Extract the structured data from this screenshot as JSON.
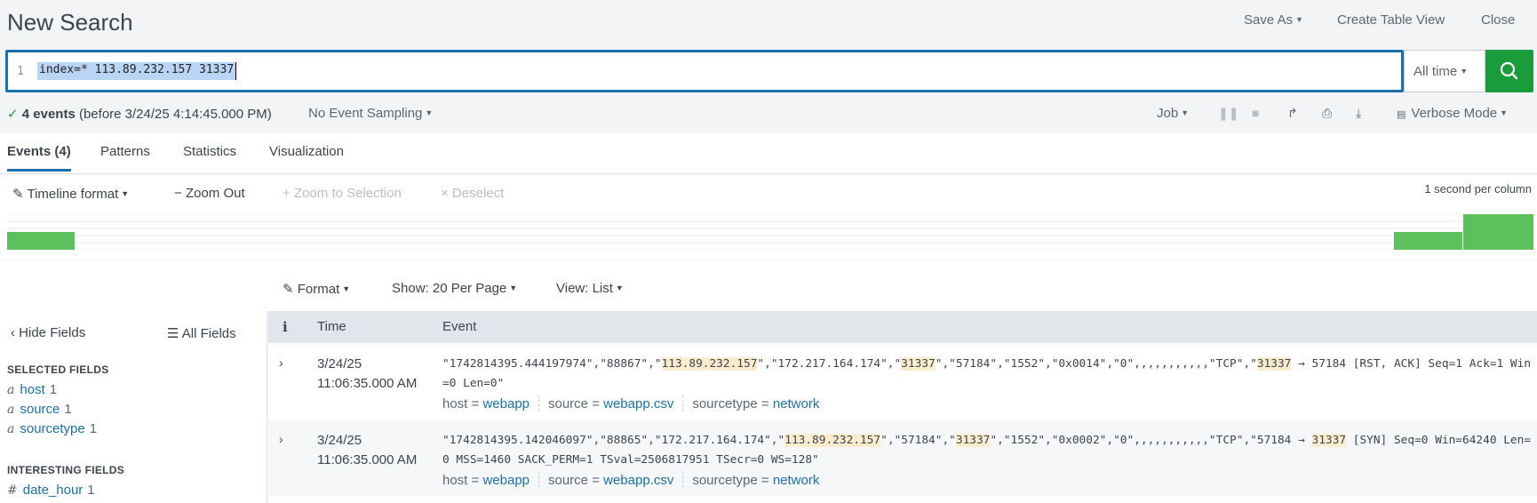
{
  "header": {
    "title": "New Search",
    "save_as": "Save As",
    "create_table_view": "Create Table View",
    "close": "Close"
  },
  "search": {
    "line_number": "1",
    "query": "index=* 113.89.232.157 31337",
    "time_range": "All time"
  },
  "status": {
    "event_count": "4 events",
    "event_time": "(before 3/24/25 4:14:45.000 PM)",
    "sampling": "No Event Sampling",
    "job": "Job",
    "mode": "Verbose Mode"
  },
  "tabs": [
    {
      "label": "Events (4)",
      "active": true
    },
    {
      "label": "Patterns",
      "active": false
    },
    {
      "label": "Statistics",
      "active": false
    },
    {
      "label": "Visualization",
      "active": false
    }
  ],
  "timeline": {
    "format": "Timeline format",
    "zoom_out": "Zoom Out",
    "zoom_selection": "+ Zoom to Selection",
    "deselect": "× Deselect",
    "per_column": "1 second per column",
    "buckets": [
      {
        "position": "first",
        "count": 1
      },
      {
        "position": "second-to-last",
        "count": 1
      },
      {
        "position": "last",
        "count": 2
      }
    ],
    "bar_color": "#5cc05c"
  },
  "results": {
    "format": "Format",
    "show": "Show: 20 Per Page",
    "view": "View: List"
  },
  "sidebar": {
    "hide_fields": "Hide Fields",
    "all_fields": "All Fields",
    "selected_heading": "SELECTED FIELDS",
    "selected": [
      {
        "type": "a",
        "name": "host",
        "count": "1"
      },
      {
        "type": "a",
        "name": "source",
        "count": "1"
      },
      {
        "type": "a",
        "name": "sourcetype",
        "count": "1"
      }
    ],
    "interesting_heading": "INTERESTING FIELDS",
    "interesting": [
      {
        "type": "#",
        "name": "date_hour",
        "count": "1"
      }
    ]
  },
  "events_table": {
    "col_info": "i",
    "col_time": "Time",
    "col_event": "Event",
    "rows": [
      {
        "date": "3/24/25",
        "time": "11:06:35.000 AM",
        "raw_segments": [
          {
            "t": "\"1742814395.444197974\",\"88867\",\"",
            "h": false
          },
          {
            "t": "113.89.232.157",
            "h": true
          },
          {
            "t": "\",\"172.217.164.174\",\"",
            "h": false
          },
          {
            "t": "31337",
            "h": true
          },
          {
            "t": "\",\"57184\",\"1552\",\"0x0014\",\"0\",,,,,,,,,,,\"TCP\",\"",
            "h": false
          },
          {
            "t": "31337",
            "h": true
          },
          {
            "t": " → 57184 [RST, ACK] Seq=1 Ack=1 Win=0 Len=0\"",
            "h": false
          }
        ],
        "host": "webapp",
        "source": "webapp.csv",
        "sourcetype": "network"
      },
      {
        "date": "3/24/25",
        "time": "11:06:35.000 AM",
        "raw_segments": [
          {
            "t": "\"1742814395.142046097\",\"88865\",\"172.217.164.174\",\"",
            "h": false
          },
          {
            "t": "113.89.232.157",
            "h": true
          },
          {
            "t": "\",\"57184\",\"",
            "h": false
          },
          {
            "t": "31337",
            "h": true
          },
          {
            "t": "\",\"1552\",\"0x0002\",\"0\",,,,,,,,,,,\"TCP\",\"57184 → ",
            "h": false
          },
          {
            "t": "31337",
            "h": true
          },
          {
            "t": " [SYN] Seq=0 Win=64240 Len=0 MSS=1460 SACK_PERM=1 TSval=2506817951 TSecr=0 WS=128\"",
            "h": false
          }
        ],
        "host": "webapp",
        "source": "webapp.csv",
        "sourcetype": "network"
      }
    ],
    "meta_keys": {
      "host": "host =",
      "source": "source =",
      "sourcetype": "sourcetype ="
    }
  }
}
